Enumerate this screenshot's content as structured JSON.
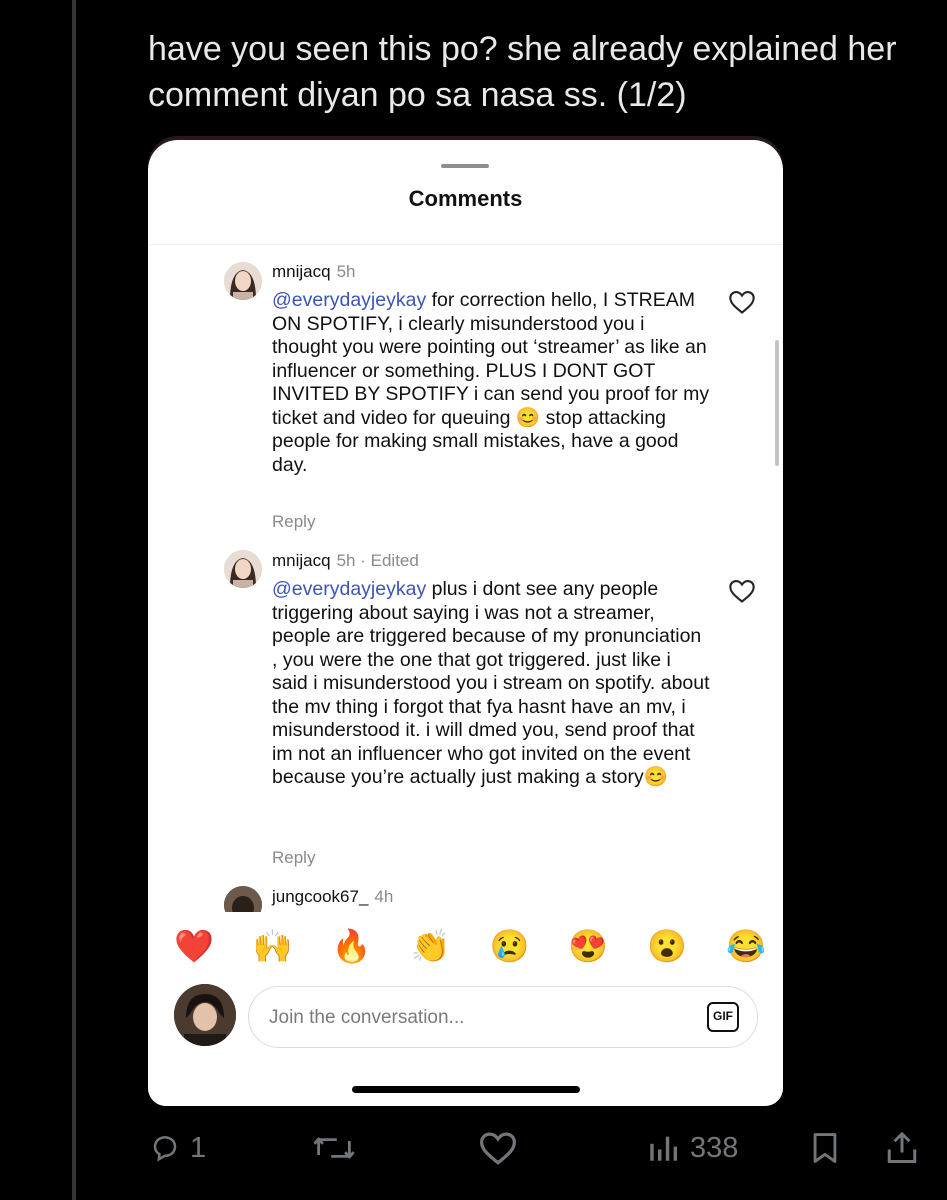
{
  "tweet": {
    "text": "have you seen this po? she already explained her comment diyan po sa nasa ss. (1/2)"
  },
  "screenshot": {
    "sheet_title": "Comments",
    "comments": [
      {
        "username": "mnijacq",
        "time": "5h",
        "edited": "",
        "mention": "@everydayjeykay",
        "text": " for correction hello, I STREAM ON SPOTIFY, i clearly misunderstood you i thought you were pointing out ‘streamer’ as like an influencer or something. PLUS I DONT GOT INVITED BY SPOTIFY i can send you proof for my ticket and video for queuing 😊 stop attacking people for making small mistakes, have a good day.",
        "reply_label": "Reply"
      },
      {
        "username": "mnijacq",
        "time": "5h",
        "edited": " · Edited",
        "mention": "@everydayjeykay",
        "text": " plus i dont see any people triggering about saying i was not a streamer, people are triggered because of my pronunciation , you were the one that got triggered. just like i said i misunderstood you i stream on spotify. about the mv thing i forgot that fya hasnt have an mv, i misunderstood it. i will dmed you, send proof that im not an influencer who got invited on the event because you’re actually just making a story😊",
        "reply_label": "Reply"
      },
      {
        "username": "jungcook67_",
        "time": "4h"
      }
    ],
    "reactions": [
      "❤️",
      "🙌",
      "🔥",
      "👏",
      "😢",
      "😍",
      "😮",
      "😂"
    ],
    "input_placeholder": "Join the conversation...",
    "gif_label": "GIF"
  },
  "actions": {
    "reply_count": "1",
    "views_count": "338"
  },
  "colors": {
    "mention": "#3d55b5",
    "secondary_text": "#8a8a8a",
    "x_icon": "#71767b"
  }
}
